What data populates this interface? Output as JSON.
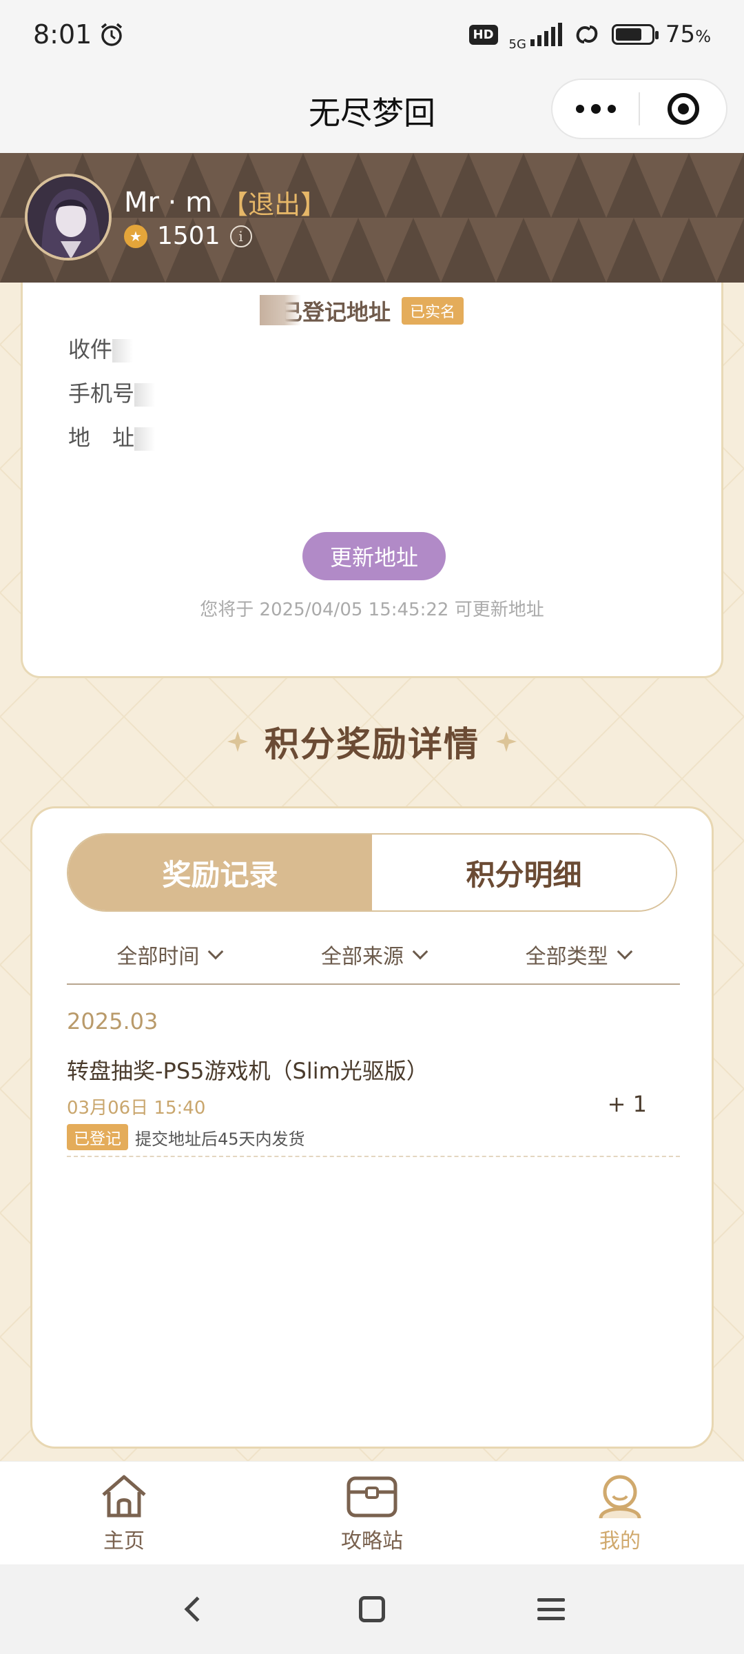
{
  "status_bar": {
    "time": "8:01",
    "hd": "HD",
    "network": "5G",
    "battery": "75",
    "battery_unit": "%",
    "battery_level": 0.75
  },
  "title_bar": {
    "title": "无尽梦回"
  },
  "user": {
    "name": "Mr · m",
    "logout": "【退出】",
    "points": "1501"
  },
  "address_card": {
    "title": "已登记地址",
    "verified_badge": "已实名",
    "recipient_label": "收件",
    "phone_label": "手机号",
    "address_label": "地　址",
    "update_button": "更新地址",
    "update_note": "您将于 2025/04/05 15:45:22 可更新地址"
  },
  "rewards_section": {
    "heading": "积分奖励详情",
    "tabs": [
      {
        "label": "奖励记录",
        "active": true
      },
      {
        "label": "积分明细",
        "active": false
      }
    ],
    "filters": [
      {
        "label": "全部时间"
      },
      {
        "label": "全部来源"
      },
      {
        "label": "全部类型"
      }
    ],
    "month": "2025.03",
    "records": [
      {
        "title": "转盘抽奖-PS5游戏机（Slim光驱版）",
        "time": "03月06日 15:40",
        "tag": "已登记",
        "note": "提交地址后45天内发货",
        "delta": "+ 1"
      }
    ]
  },
  "bottom_nav": {
    "items": [
      {
        "label": "主页",
        "icon": "home-icon",
        "active": false
      },
      {
        "label": "攻略站",
        "icon": "chest-icon",
        "active": false
      },
      {
        "label": "我的",
        "icon": "profile-icon",
        "active": true
      }
    ]
  },
  "colors": {
    "header_brown": "#6f5a4b",
    "accent_gold": "#d9bb90",
    "badge_orange": "#e4ac5a",
    "button_purple": "#b18ac7",
    "page_beige": "#f6eddb"
  }
}
